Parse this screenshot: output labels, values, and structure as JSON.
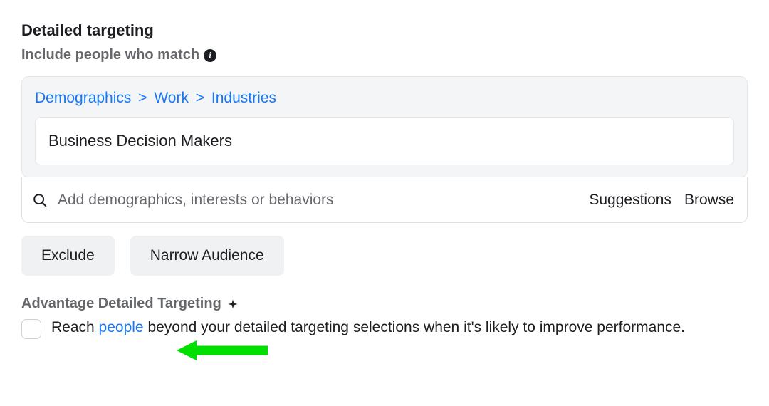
{
  "section": {
    "title": "Detailed targeting",
    "subtitle": "Include people who match"
  },
  "breadcrumb": {
    "level1": "Demographics",
    "level2": "Work",
    "level3": "Industries"
  },
  "selection": {
    "value": "Business Decision Makers"
  },
  "search": {
    "placeholder": "Add demographics, interests or behaviors",
    "suggestions_label": "Suggestions",
    "browse_label": "Browse"
  },
  "buttons": {
    "exclude": "Exclude",
    "narrow": "Narrow Audience"
  },
  "advantage": {
    "label": "Advantage Detailed Targeting",
    "text_prefix": "Reach ",
    "text_link": "people",
    "text_suffix": " beyond your detailed targeting selections when it's likely to improve performance."
  }
}
